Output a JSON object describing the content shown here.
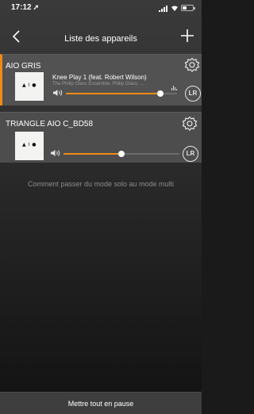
{
  "status_bar": {
    "time": "17:12",
    "location_arrow": "location-arrow-icon",
    "battery_level": 0.4
  },
  "nav": {
    "title": "Liste des appareils",
    "back_icon": "chevron-left-icon",
    "add_icon": "plus-icon"
  },
  "devices": [
    {
      "name": "AIO GRIS",
      "selected": true,
      "track": "Knee Play 1 (feat. Robert Wilson)",
      "artist": "The Philip Glass Ensemble, Philip Glass, ...",
      "volume": 0.85,
      "lr_label": "LR",
      "cover_text": "▲ I ●"
    },
    {
      "name": "TRIANGLE AIO C_BD58",
      "selected": false,
      "track": "",
      "artist": "",
      "volume": 0.5,
      "lr_label": "LR",
      "cover_text": "▲ I ●"
    }
  ],
  "help_text": "Comment passer du mode solo au mode multi",
  "bottom": {
    "pause_label": "Mettre tout en pause"
  },
  "colors": {
    "accent": "#f08a14",
    "card": "#4d4d4d",
    "background": "#1a1a1a"
  }
}
